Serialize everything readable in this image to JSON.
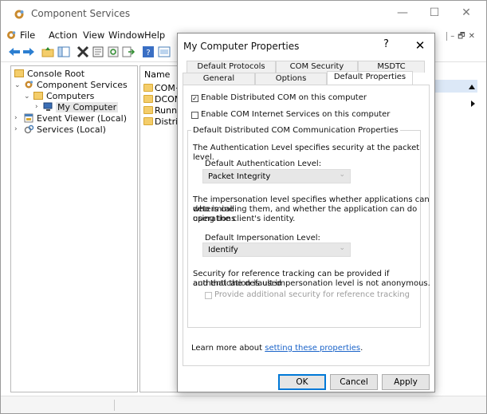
{
  "window": {
    "title": "Component Services",
    "minimize_glyph": "—",
    "maximize_glyph": "☐",
    "close_glyph": "✕"
  },
  "menu": {
    "items": [
      "File",
      "Action",
      "View",
      "Window",
      "Help"
    ]
  },
  "mdi_controls": {
    "minimize": "–",
    "restore": "🗗",
    "close": "✕"
  },
  "tree": {
    "console_root": "Console Root",
    "component_services": "Component Services",
    "computers": "Computers",
    "my_computer": "My Computer",
    "event_viewer": "Event Viewer (Local)",
    "services": "Services (Local)"
  },
  "list": {
    "column_name": "Name",
    "items": [
      "COM+",
      "DCOM",
      "Runnir",
      "Distrib"
    ]
  },
  "dialog": {
    "title": "My Computer Properties",
    "help": "?",
    "close": "✕",
    "tabs_row1": [
      "Default Protocols",
      "COM Security",
      "MSDTC"
    ],
    "tabs_row2": [
      "General",
      "Options",
      "Default Properties"
    ],
    "active_tab": "Default Properties",
    "enable_dcom": {
      "label": "Enable Distributed COM on this computer",
      "checked": true
    },
    "enable_cis": {
      "label": "Enable COM Internet Services on this computer",
      "checked": false
    },
    "group_title": "Default Distributed COM Communication Properties",
    "auth_desc": "The Authentication Level specifies security at the packet level.",
    "auth_label": "Default Authentication Level:",
    "auth_value": "Packet Integrity",
    "imp_desc_1": "The impersonation level specifies whether applications can determine",
    "imp_desc_2": "who is calling them, and whether the application can do operations",
    "imp_desc_3": "using the client's identity.",
    "imp_label": "Default Impersonation Level:",
    "imp_value": "Identify",
    "ref_desc_1": "Security for reference tracking can be provided if authentication is used",
    "ref_desc_2": "and that the default impersonation level is not anonymous.",
    "ref_tracking": {
      "label": "Provide additional security for reference tracking",
      "checked": false,
      "enabled": false
    },
    "learn_more_prefix": "Learn more about ",
    "learn_more_link": "setting these properties",
    "learn_more_suffix": ".",
    "ok": "OK",
    "cancel": "Cancel",
    "apply": "Apply",
    "combo_arrow": "⌄",
    "check_glyph": "✓"
  },
  "colors": {
    "accent": "#0078d7",
    "link": "#1a63c9",
    "selection_bg": "#dce8f7"
  }
}
